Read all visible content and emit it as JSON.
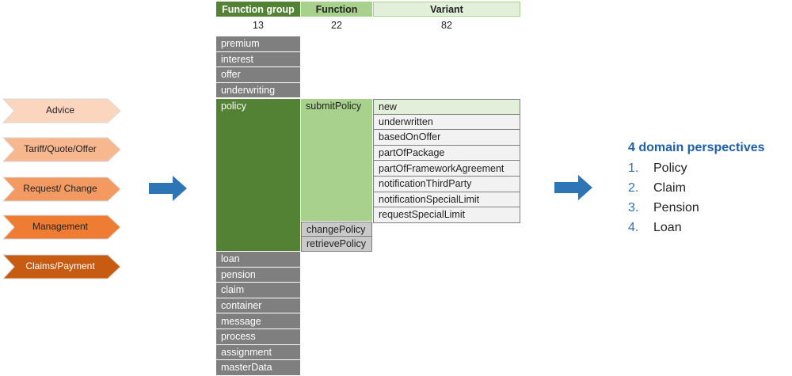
{
  "stages": [
    {
      "label": "Advice",
      "color": "#fbd5be"
    },
    {
      "label": "Tariff/Quote/Offer",
      "color": "#f7b890"
    },
    {
      "label": "Request/ Change",
      "color": "#f39a62"
    },
    {
      "label": "Management",
      "color": "#ee7c33"
    },
    {
      "label": "Claims/Payment",
      "color": "#c65b11"
    }
  ],
  "headers": {
    "function_group": "Function group",
    "function": "Function",
    "variant": "Variant"
  },
  "counts": {
    "function_group": "13",
    "function": "22",
    "variant": "82"
  },
  "function_groups_before": [
    "premium",
    "interest",
    "offer",
    "underwriting"
  ],
  "policy_group": "policy",
  "function_groups_after": [
    "loan",
    "pension",
    "claim",
    "container",
    "message",
    "process",
    "assignment",
    "masterData"
  ],
  "functions": {
    "submit": "submitPolicy",
    "change": "changePolicy",
    "retrieve": "retrievePolicy"
  },
  "variants": [
    "new",
    "underwritten",
    "basedOnOffer",
    "partOfPackage",
    "partOfFrameworkAgreement",
    "notificationThirdParty",
    "notificationSpecialLimit",
    "requestSpecialLimit"
  ],
  "perspectives": {
    "title": "4 domain perspectives",
    "items": [
      {
        "num": "1.",
        "label": "Policy"
      },
      {
        "num": "2.",
        "label": "Claim"
      },
      {
        "num": "3.",
        "label": "Pension"
      },
      {
        "num": "4.",
        "label": "Loan"
      }
    ]
  },
  "colors": {
    "header_dark_green": "#548235",
    "header_light_green": "#a9d18e",
    "header_pale_green": "#e2efd9",
    "function_group_gray": "#7f7f7f",
    "arrow_blue": "#2e75b6"
  }
}
